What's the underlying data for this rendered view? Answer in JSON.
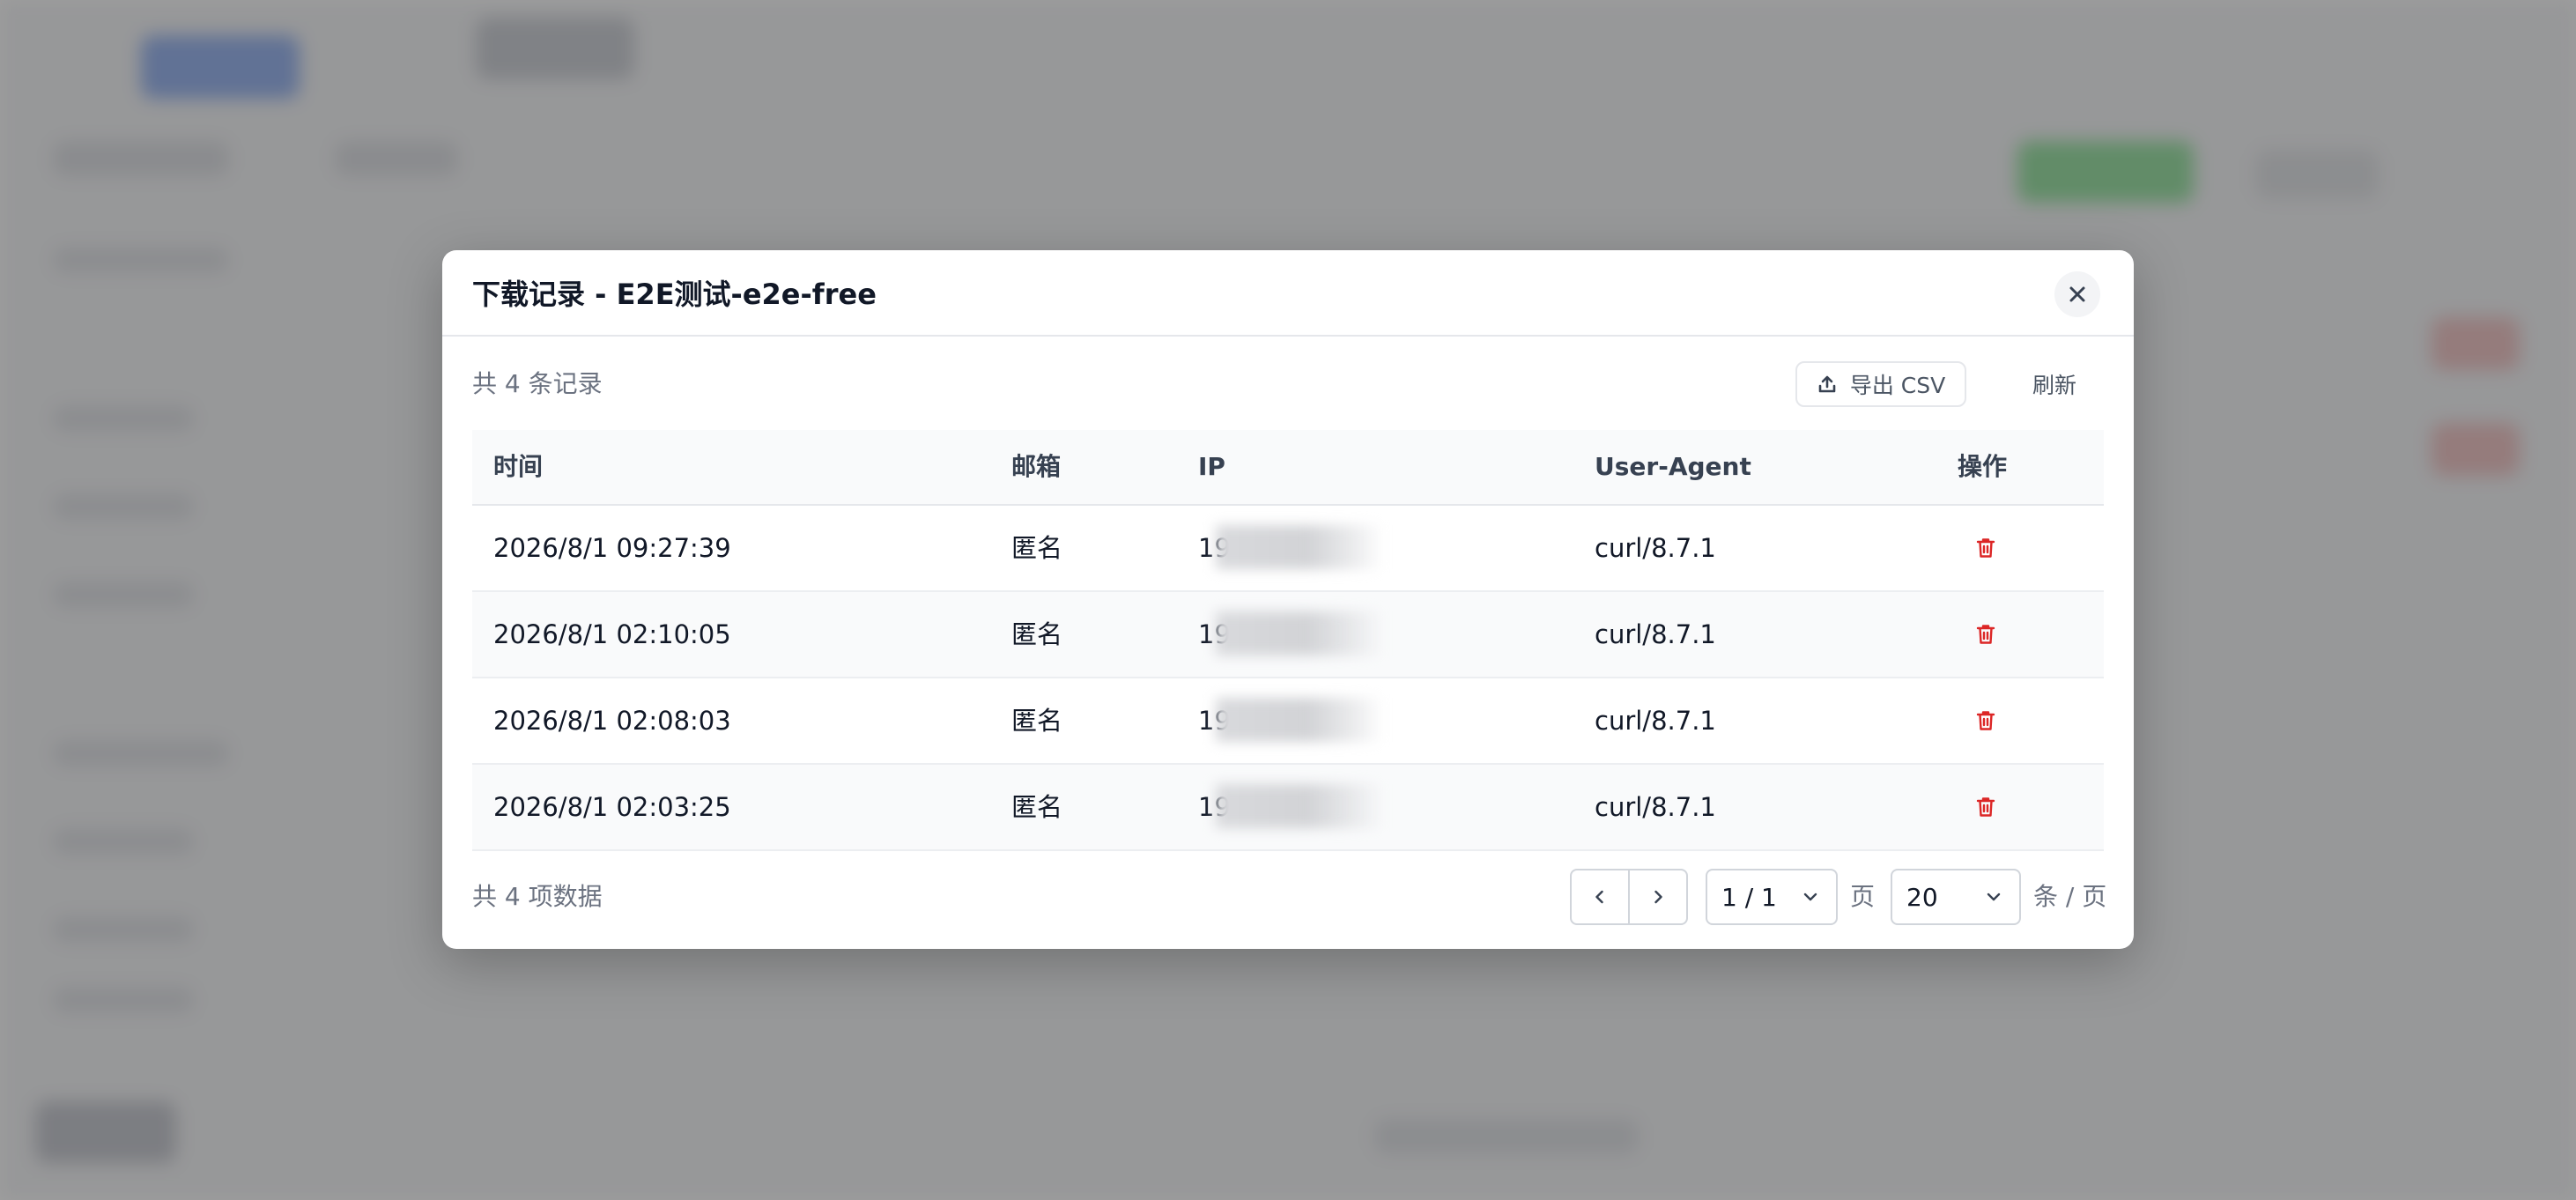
{
  "colors": {
    "danger": "#dc2626",
    "text_primary": "#111827",
    "text_muted": "#6b7280",
    "border": "#e5e7eb",
    "row_alt": "#f9fafb",
    "overlay": "rgba(0,0,0,0.38)"
  },
  "modal": {
    "title": "下载记录 - E2E测试-e2e-free",
    "close_icon": "close-icon"
  },
  "toolbar": {
    "count_text": "共 4 条记录",
    "export_label": "导出 CSV",
    "export_icon": "upload-icon",
    "refresh_label": "刷新"
  },
  "table": {
    "columns": [
      "时间",
      "邮箱",
      "IP",
      "User-Agent",
      "操作"
    ],
    "rows": [
      {
        "time": "2026/8/1 09:27:39",
        "email": "匿名",
        "ip_visible": "19",
        "user_agent": "curl/8.7.1",
        "action_icon": "trash-icon"
      },
      {
        "time": "2026/8/1 02:10:05",
        "email": "匿名",
        "ip_visible": "19",
        "user_agent": "curl/8.7.1",
        "action_icon": "trash-icon"
      },
      {
        "time": "2026/8/1 02:08:03",
        "email": "匿名",
        "ip_visible": "19",
        "user_agent": "curl/8.7.1",
        "action_icon": "trash-icon"
      },
      {
        "time": "2026/8/1 02:03:25",
        "email": "匿名",
        "ip_visible": "19",
        "user_agent": "curl/8.7.1",
        "action_icon": "trash-icon"
      }
    ]
  },
  "footer": {
    "total_text": "共 4 项数据",
    "prev_icon": "chevron-left-icon",
    "next_icon": "chevron-right-icon",
    "page_value": "1 / 1",
    "page_label": "页",
    "page_size_value": "20",
    "page_size_label": "条 / 页"
  }
}
